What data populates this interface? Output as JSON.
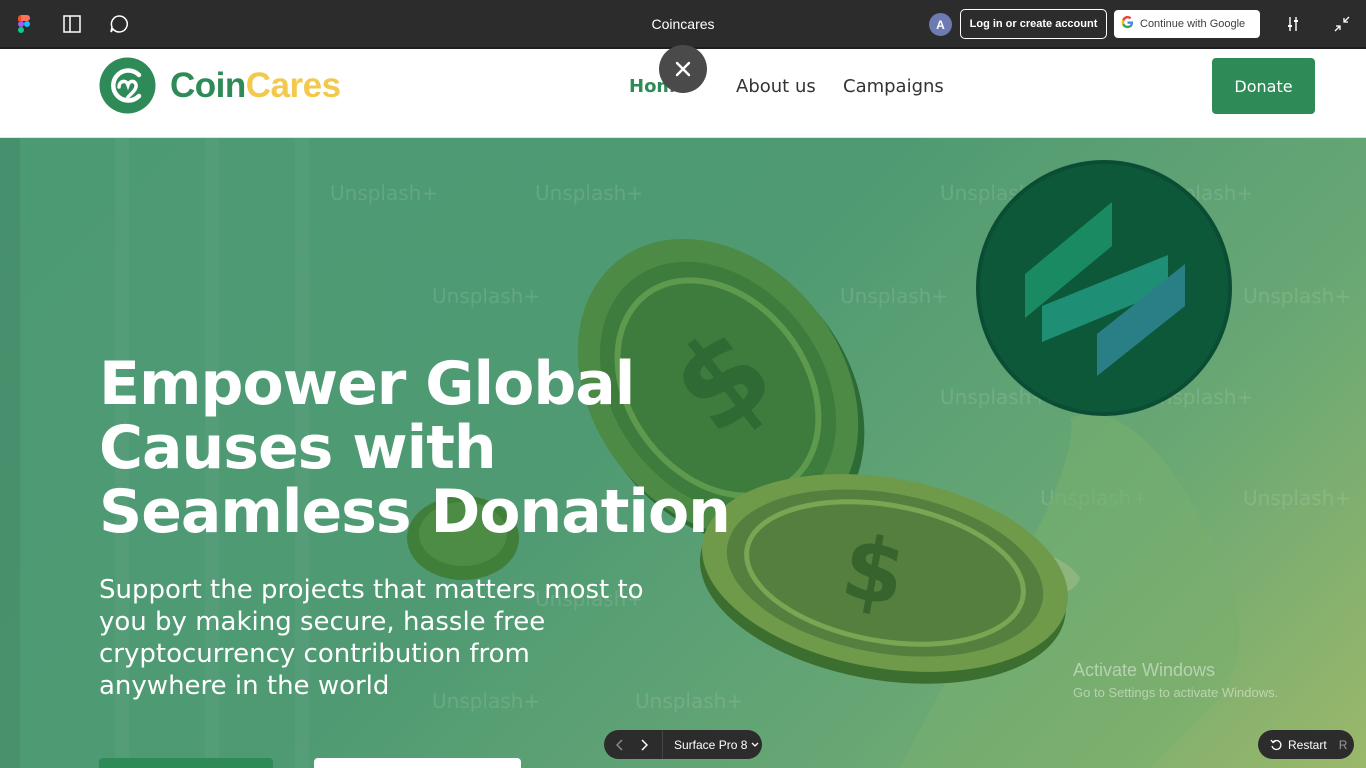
{
  "figma_bar": {
    "title": "Coincares",
    "avatar_letter": "A",
    "login_label": "Log in or create account",
    "google_label": "Continue with Google"
  },
  "site": {
    "logo_text_1": "Coin",
    "logo_text_2": "Cares",
    "nav": [
      {
        "label": "Home",
        "active": true
      },
      {
        "label": "About us",
        "active": false
      },
      {
        "label": "Campaigns",
        "active": false
      }
    ],
    "donate_label": "Donate"
  },
  "hero": {
    "title": "Empower Global Causes with Seamless Donation",
    "subtitle": "Support the projects  that matters most to you by making secure, hassle free cryptocurrency contribution from anywhere in the world",
    "image_watermark": "Unsplash+"
  },
  "windows_watermark": {
    "title": "Activate Windows",
    "subtitle": "Go to Settings to activate Windows."
  },
  "prototype_controls": {
    "device": "Surface Pro 8",
    "restart_label": "Restart",
    "restart_shortcut": "R"
  },
  "colors": {
    "brand_green": "#2e8b57",
    "brand_yellow": "#f2c94c",
    "figma_dark": "#2c2c2c"
  }
}
